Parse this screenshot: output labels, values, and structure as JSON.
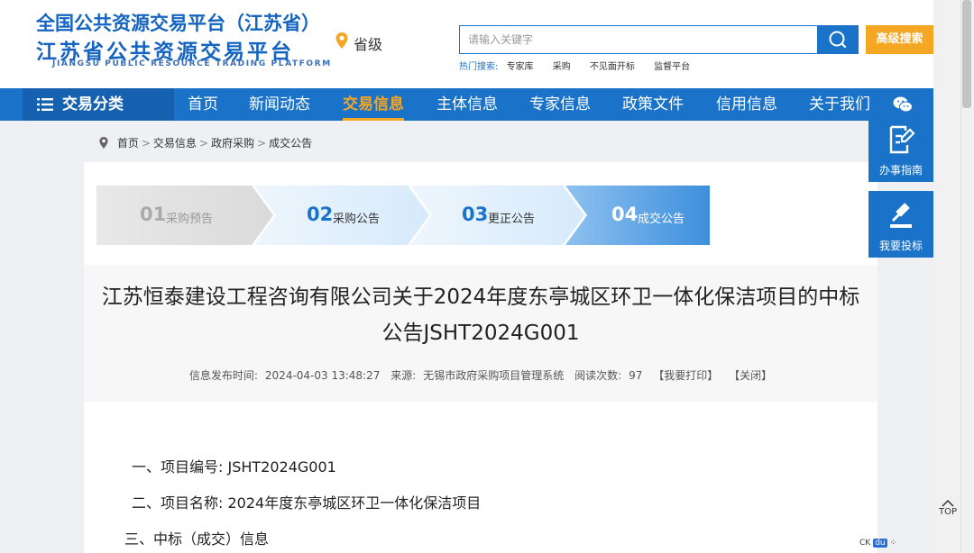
{
  "header": {
    "logo_line1": "全国公共资源交易平台（江苏省）",
    "logo_line2": "江苏省公共资源交易平台",
    "logo_en": "JIANGSU PUBLIC RESOURCE TRADING PLATFORM",
    "location": "省级",
    "search_placeholder": "请输入关键字",
    "advanced_search": "高级搜索",
    "hot_label": "热门搜索:",
    "hot_keywords": [
      "专家库",
      "采购",
      "不见面开标",
      "监督平台"
    ]
  },
  "nav": {
    "category": "交易分类",
    "items": [
      "首页",
      "新闻动态",
      "交易信息",
      "主体信息",
      "专家信息",
      "政策文件",
      "信用信息",
      "关于我们"
    ],
    "active_index": 2
  },
  "breadcrumb": [
    "首页",
    "交易信息",
    "政府采购",
    "成交公告"
  ],
  "steps": [
    {
      "num": "01",
      "label": "采购预告"
    },
    {
      "num": "02",
      "label": "采购公告"
    },
    {
      "num": "03",
      "label": "更正公告"
    },
    {
      "num": "04",
      "label": "成交公告"
    }
  ],
  "article": {
    "title": "江苏恒泰建设工程咨询有限公司关于2024年度东亭城区环卫一体化保洁项目的中标公告JSHT2024G001",
    "publish_label": "信息发布时间:",
    "publish_time": "2024-04-03 13:48:27",
    "source_label": "来源:",
    "source": "无锡市政府采购项目管理系统",
    "views_label": "阅读次数:",
    "views": "97",
    "print": "【我要打印】",
    "close": "【关闭】",
    "lines": [
      "一、项目编号:   JSHT2024G001",
      "二、项目名称:   2024年度东亭城区环卫一体化保洁项目",
      "三、中标（成交）信息"
    ]
  },
  "float": {
    "guide": "办事指南",
    "bid": "我要投标"
  },
  "top_label": "TOP",
  "tray": {
    "ck": "CK",
    "du": "du"
  },
  "colors": {
    "primary": "#1a73c8",
    "accent": "#f5a623"
  }
}
